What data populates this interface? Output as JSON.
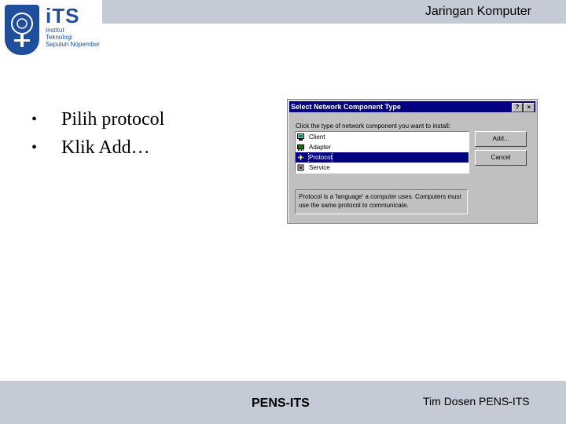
{
  "header": {
    "title": "Jaringan Komputer"
  },
  "logo": {
    "name": "iTS",
    "lines": [
      "Institut",
      "Teknologi",
      "Sepuluh Nopember"
    ]
  },
  "bullets": [
    {
      "dot": "•",
      "text": "Pilih protocol"
    },
    {
      "dot": "•",
      "text": "Klik Add…"
    }
  ],
  "dialog": {
    "title": "Select Network Component Type",
    "help_label": "?",
    "close_label": "×",
    "prompt": "Click the type of network component you want to install:",
    "items": [
      {
        "label": "Client",
        "icon": "client-icon"
      },
      {
        "label": "Adapter",
        "icon": "adapter-icon"
      },
      {
        "label": "Protocol",
        "icon": "protocol-icon",
        "selected": true
      },
      {
        "label": "Service",
        "icon": "service-icon"
      }
    ],
    "add_label": "Add...",
    "cancel_label": "Cancel",
    "description": "Protocol is a 'language' a computer uses. Computers must use the same protocol to communicate."
  },
  "footer": {
    "center": "PENS-ITS",
    "right": "Tim Dosen PENS-ITS"
  }
}
